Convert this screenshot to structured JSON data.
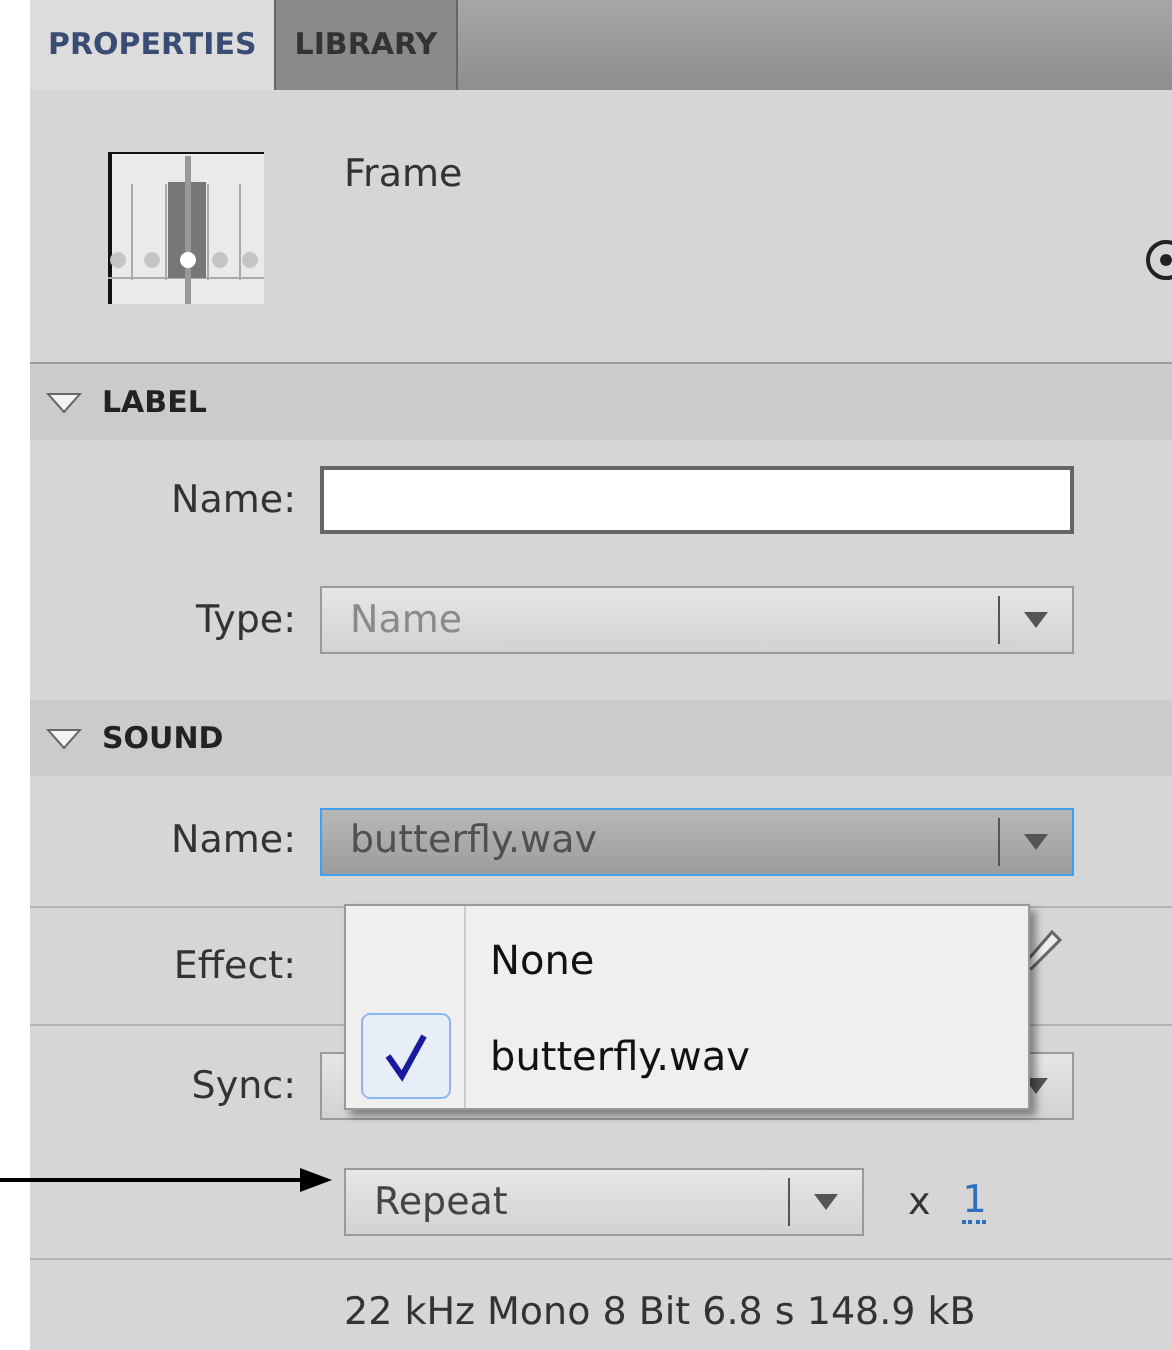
{
  "tabs": [
    {
      "label": "PROPERTIES",
      "selected": true
    },
    {
      "label": "LIBRARY",
      "selected": false
    }
  ],
  "header": {
    "title": "Frame"
  },
  "sections": [
    {
      "title": "LABEL",
      "expanded": true,
      "rows": [
        {
          "kind": "text",
          "label": "Name:"
        },
        {
          "kind": "select",
          "label": "Type:",
          "value": "Name",
          "disabled": true,
          "focused": false
        }
      ]
    },
    {
      "title": "SOUND",
      "expanded": true,
      "rows": [
        {
          "kind": "select",
          "label": "Name:",
          "value": "butterfly.wav",
          "disabled": false,
          "focused": true
        },
        {
          "kind": "effect",
          "label": "Effect:"
        },
        {
          "kind": "select",
          "label": "Sync:",
          "disabled": false,
          "focused": false
        },
        {
          "kind": "repeat",
          "value": "Repeat",
          "disabled": false,
          "focused": false,
          "times": "x",
          "count": "1"
        }
      ]
    }
  ],
  "info": "22 kHz Mono 8 Bit 6.8 s 148.9 kB",
  "menu": {
    "items": [
      {
        "label": "None",
        "selected": false
      },
      {
        "label": "butterfly.wav",
        "selected": true
      }
    ]
  }
}
